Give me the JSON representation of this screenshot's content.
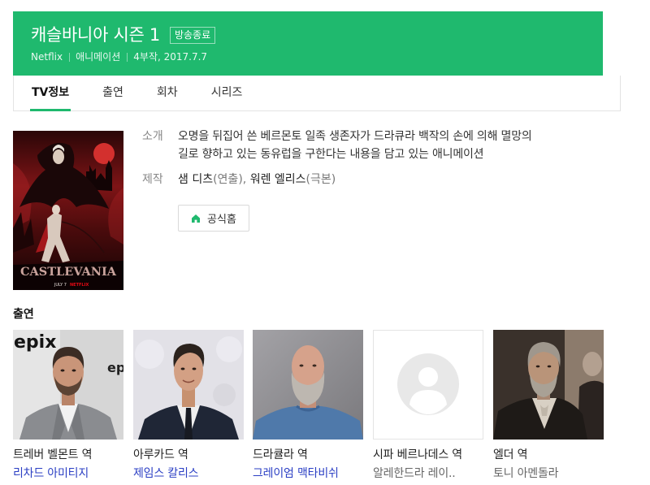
{
  "colors": {
    "brand": "#1fb96e",
    "link": "#2b3fc4",
    "text": "#222222",
    "muted": "#888888"
  },
  "header": {
    "title": "캐슬바니아 시즌 1",
    "badge": "방송종료",
    "meta": [
      "Netflix",
      "애니메이션",
      "4부작, 2017.7.7"
    ]
  },
  "active_tab": 0,
  "tabs": [
    {
      "label": "TV정보"
    },
    {
      "label": "출연"
    },
    {
      "label": "회차"
    },
    {
      "label": "시리즈"
    }
  ],
  "poster": {
    "title": "CASTLEVANIA",
    "date": "JULY 7",
    "network": "NETFLIX"
  },
  "info": {
    "intro_label": "소개",
    "intro_lines": [
      "오명을 뒤집어 쓴 베르몬토 일족 생존자가 드라큐라 백작의 손에 의해 멸망의",
      "길로 향하고 있는 동유럽을 구한다는 내용을 담고 있는 애니메이션"
    ],
    "credits_label": "제작",
    "credits": [
      {
        "name": "샘 디츠",
        "role": "(연출)"
      },
      {
        "name": "워렌 엘리스",
        "role": "(극본)"
      }
    ],
    "credits_separator": ", ",
    "official_button": "공식홈",
    "official_icon": "home-icon"
  },
  "cast_section": {
    "heading": "출연"
  },
  "photo_logo": "epix",
  "cast": [
    {
      "role": "트레버 벨몬트 역",
      "actor": "리차드 아미티지",
      "linked": true
    },
    {
      "role": "아루카드 역",
      "actor": "제임스 칼리스",
      "linked": true
    },
    {
      "role": "드라큘라 역",
      "actor": "그레이엄 맥타비쉬",
      "linked": true
    },
    {
      "role": "시파 베르나데스 역",
      "actor": "알레한드라 레이..",
      "linked": false
    },
    {
      "role": "엘더 역",
      "actor": "토니 아멘돌라",
      "linked": false
    }
  ]
}
